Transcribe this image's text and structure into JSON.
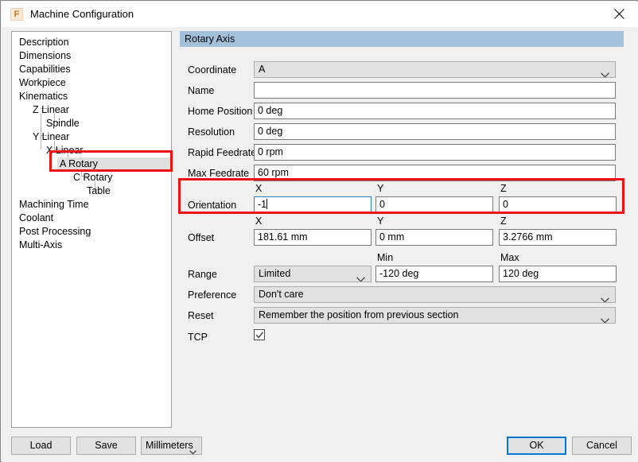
{
  "window": {
    "title": "Machine Configuration",
    "app_icon": "F",
    "close_icon": "close-icon"
  },
  "tree": {
    "items": [
      {
        "label": "Description",
        "depth": 0,
        "selected": false
      },
      {
        "label": "Dimensions",
        "depth": 0,
        "selected": false
      },
      {
        "label": "Capabilities",
        "depth": 0,
        "selected": false
      },
      {
        "label": "Workpiece",
        "depth": 0,
        "selected": false
      },
      {
        "label": "Kinematics",
        "depth": 0,
        "selected": false
      },
      {
        "label": "Z Linear",
        "depth": 1,
        "selected": false
      },
      {
        "label": "Spindle",
        "depth": 2,
        "selected": false
      },
      {
        "label": "Y Linear",
        "depth": 1,
        "selected": false
      },
      {
        "label": "X Linear",
        "depth": 2,
        "selected": false
      },
      {
        "label": "A Rotary",
        "depth": 3,
        "selected": true
      },
      {
        "label": "C Rotary",
        "depth": 4,
        "selected": false
      },
      {
        "label": "Table",
        "depth": 5,
        "selected": false
      },
      {
        "label": "Machining Time",
        "depth": 0,
        "selected": false
      },
      {
        "label": "Coolant",
        "depth": 0,
        "selected": false
      },
      {
        "label": "Post Processing",
        "depth": 0,
        "selected": false
      },
      {
        "label": "Multi-Axis",
        "depth": 0,
        "selected": false
      }
    ]
  },
  "panel": {
    "header": "Rotary Axis",
    "fields": {
      "coordinate_label": "Coordinate",
      "coordinate_value": "A",
      "name_label": "Name",
      "name_value": "",
      "home_position_label": "Home Position",
      "home_position_value": "0 deg",
      "resolution_label": "Resolution",
      "resolution_value": "0 deg",
      "rapid_feedrate_label": "Rapid Feedrate",
      "rapid_feedrate_value": "0 rpm",
      "max_feedrate_label": "Max Feedrate",
      "max_feedrate_value": "60 rpm",
      "orientation_label": "Orientation",
      "orientation_x_header": "X",
      "orientation_y_header": "Y",
      "orientation_z_header": "Z",
      "orientation_x": "-1",
      "orientation_y": "0",
      "orientation_z": "0",
      "offset_label": "Offset",
      "offset_x_header": "X",
      "offset_y_header": "Y",
      "offset_z_header": "Z",
      "offset_x": "181.61 mm",
      "offset_y": "0 mm",
      "offset_z": "3.2766 mm",
      "range_label": "Range",
      "range_value": "Limited",
      "range_min_header": "Min",
      "range_max_header": "Max",
      "range_min": "-120 deg",
      "range_max": "120 deg",
      "preference_label": "Preference",
      "preference_value": "Don't care",
      "reset_label": "Reset",
      "reset_value": "Remember the position from previous section",
      "tcp_label": "TCP",
      "tcp_checked": true
    }
  },
  "footer": {
    "load_label": "Load",
    "save_label": "Save",
    "units_value": "Millimeters",
    "ok_label": "OK",
    "cancel_label": "Cancel"
  },
  "annotations": {
    "highlight_color": "#ee1111",
    "focus_color": "#2b7cb5",
    "header_color": "#a3c0da",
    "primary_button_color": "#0078d7"
  }
}
